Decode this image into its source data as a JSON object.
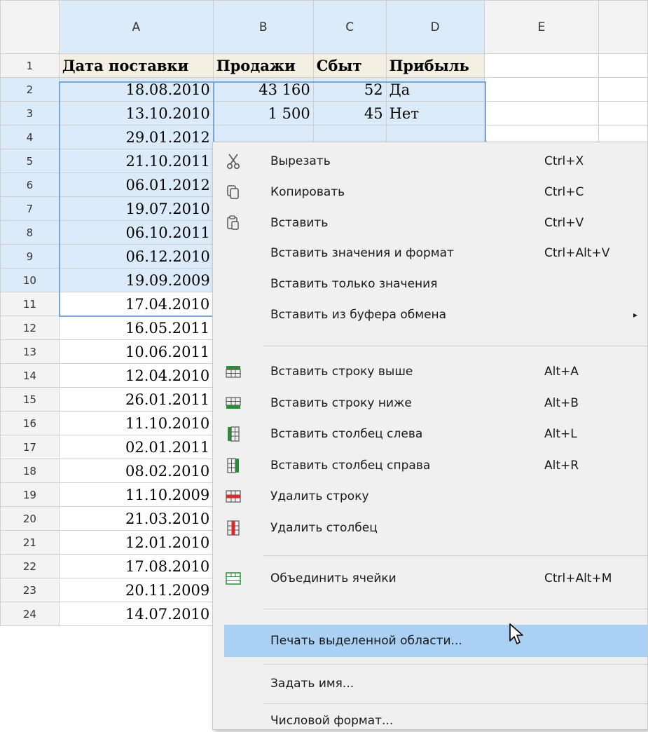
{
  "columns": [
    "A",
    "B",
    "C",
    "D",
    "E"
  ],
  "rows": [
    {
      "n": "1",
      "a": "Дата поставки",
      "b": "Продажи",
      "c": "Сбыт",
      "d": "Прибыль"
    },
    {
      "n": "2",
      "a": "18.08.2010",
      "b": "43 160",
      "c": "52",
      "d": "Да"
    },
    {
      "n": "3",
      "a": "13.10.2010",
      "b": "1 500",
      "c": "45",
      "d": "Нет"
    },
    {
      "n": "4",
      "a": "29.01.2012"
    },
    {
      "n": "5",
      "a": "21.10.2011"
    },
    {
      "n": "6",
      "a": "06.01.2012"
    },
    {
      "n": "7",
      "a": "19.07.2010"
    },
    {
      "n": "8",
      "a": "06.10.2011"
    },
    {
      "n": "9",
      "a": "06.12.2010"
    },
    {
      "n": "10",
      "a": "19.09.2009"
    },
    {
      "n": "11",
      "a": "17.04.2010"
    },
    {
      "n": "12",
      "a": "16.05.2011"
    },
    {
      "n": "13",
      "a": "10.06.2011"
    },
    {
      "n": "14",
      "a": "12.04.2010"
    },
    {
      "n": "15",
      "a": "26.01.2011"
    },
    {
      "n": "16",
      "a": "11.10.2010"
    },
    {
      "n": "17",
      "a": "02.01.2011"
    },
    {
      "n": "18",
      "a": "08.02.2010"
    },
    {
      "n": "19",
      "a": "11.10.2009"
    },
    {
      "n": "20",
      "a": "21.03.2010"
    },
    {
      "n": "21",
      "a": "12.01.2010"
    },
    {
      "n": "22",
      "a": "17.08.2010"
    },
    {
      "n": "23",
      "a": "20.11.2009"
    },
    {
      "n": "24",
      "a": "14.07.2010"
    }
  ],
  "menu": {
    "cut": {
      "label": "Вырезать",
      "shortcut": "Ctrl+X",
      "icon": "scissors-icon"
    },
    "copy": {
      "label": "Копировать",
      "shortcut": "Ctrl+C",
      "icon": "copy-icon"
    },
    "paste": {
      "label": "Вставить",
      "shortcut": "Ctrl+V",
      "icon": "paste-icon"
    },
    "paste_values_format": {
      "label": "Вставить значения и формат",
      "shortcut": "Ctrl+Alt+V"
    },
    "paste_values_only": {
      "label": "Вставить только значения"
    },
    "paste_from_clipboard": {
      "label": "Вставить из буфера обмена",
      "submenu_arrow": "▸"
    },
    "insert_row_above": {
      "label": "Вставить строку выше",
      "shortcut": "Alt+A",
      "icon": "insert-row-above-icon"
    },
    "insert_row_below": {
      "label": "Вставить строку ниже",
      "shortcut": "Alt+B",
      "icon": "insert-row-below-icon"
    },
    "insert_col_left": {
      "label": "Вставить столбец слева",
      "shortcut": "Alt+L",
      "icon": "insert-column-left-icon"
    },
    "insert_col_right": {
      "label": "Вставить столбец справа",
      "shortcut": "Alt+R",
      "icon": "insert-column-right-icon"
    },
    "delete_row": {
      "label": "Удалить строку",
      "icon": "delete-row-icon"
    },
    "delete_col": {
      "label": "Удалить столбец",
      "icon": "delete-column-icon"
    },
    "merge": {
      "label": "Объединить ячейки",
      "shortcut": "Ctrl+Alt+M",
      "icon": "merge-cells-icon"
    },
    "print_selection": {
      "label": "Печать выделенной области...",
      "highlighted": true
    },
    "define_name": {
      "label": "Задать имя..."
    },
    "number_format": {
      "label": "Числовой формат..."
    }
  },
  "colors": {
    "selection": "#dcebf9",
    "header_fill": "#f4efe3",
    "menu_bg": "#f0f0f0",
    "highlight": "#aad0f4",
    "green_icon": "#2e8b3a",
    "red_icon": "#d62b2b"
  }
}
